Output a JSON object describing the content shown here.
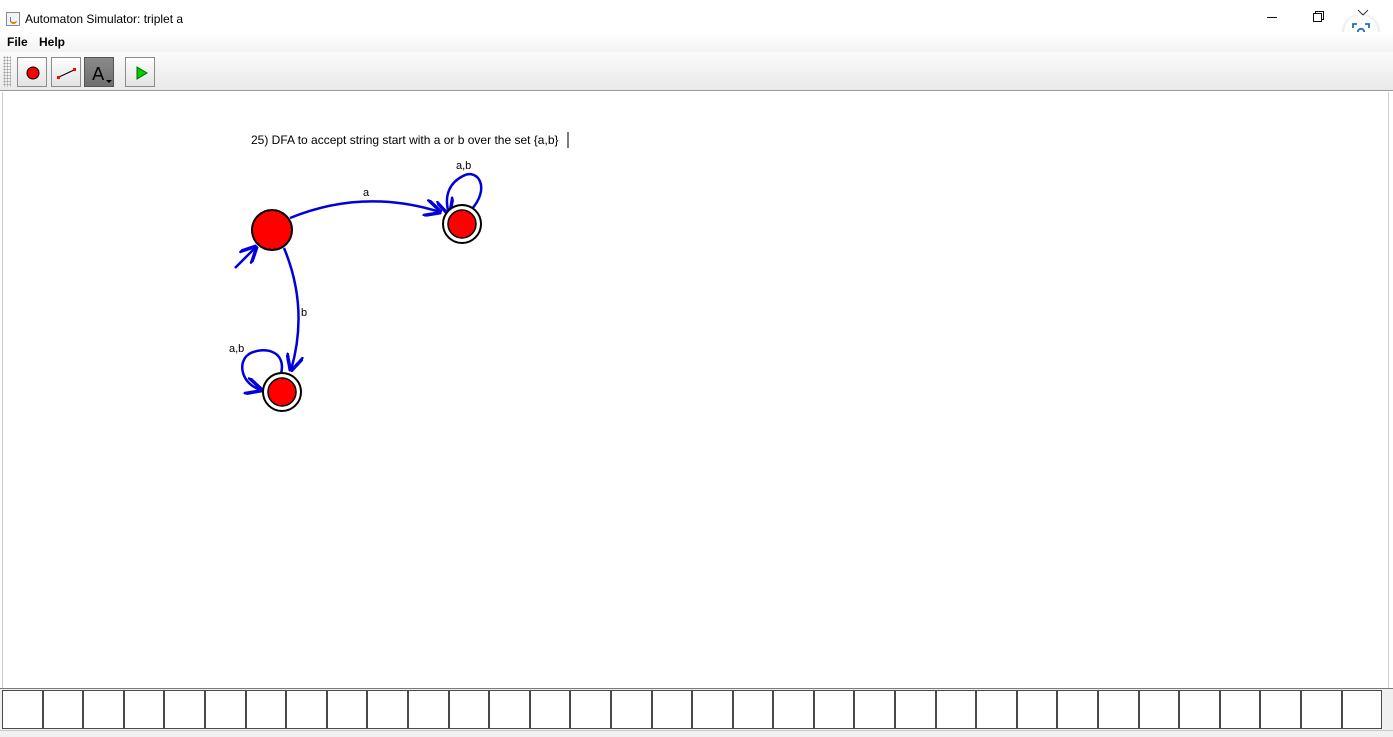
{
  "window": {
    "title": "Automaton Simulator: triplet a",
    "app_icon": "java-cup-icon"
  },
  "menubar": {
    "items": [
      "File",
      "Help"
    ]
  },
  "toolbar": {
    "tools": [
      {
        "name": "state-tool",
        "icon": "red-circle-icon"
      },
      {
        "name": "transition-tool",
        "icon": "red-line-icon"
      },
      {
        "name": "text-tool",
        "icon": "letter-a-icon",
        "label": "A",
        "selected": true
      },
      {
        "name": "run-tool",
        "icon": "green-play-icon"
      }
    ]
  },
  "canvas": {
    "annotation": "25) DFA to accept string start with a or b over the set {a,b}",
    "states": [
      {
        "id": "q0",
        "initial": true,
        "accepting": false
      },
      {
        "id": "q1",
        "initial": false,
        "accepting": true
      },
      {
        "id": "q2",
        "initial": false,
        "accepting": true
      }
    ],
    "transitions": [
      {
        "from": "q0",
        "to": "q1",
        "label": "a"
      },
      {
        "from": "q0",
        "to": "q2",
        "label": "b"
      },
      {
        "from": "q1",
        "to": "q1",
        "label": "a,b"
      },
      {
        "from": "q2",
        "to": "q2",
        "label": "a,b"
      }
    ],
    "colors": {
      "state_fill": "#ff0000",
      "transition": "#0000dd"
    }
  },
  "tape": {
    "cell_count": 34
  }
}
